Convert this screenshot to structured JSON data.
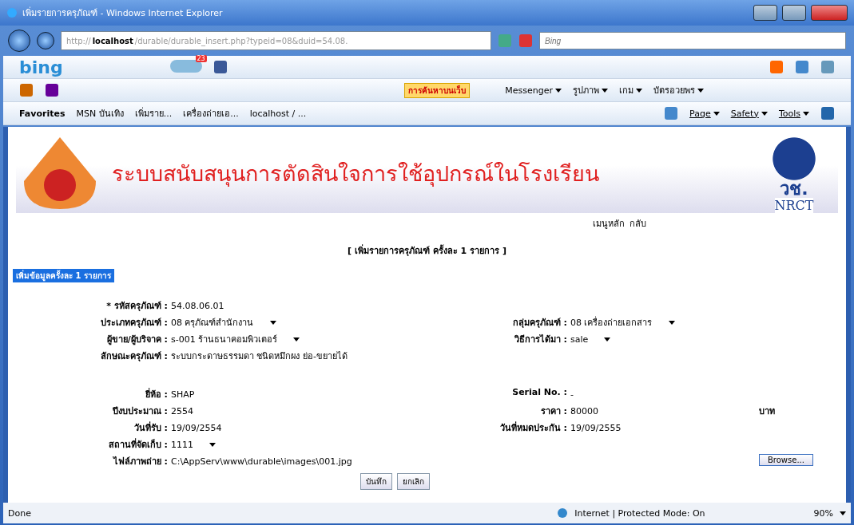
{
  "window": {
    "title": "เพิ่มรายการครุภัณฑ์ - Windows Internet Explorer"
  },
  "address_bar": {
    "url_prefix": "http://",
    "url_host": "localhost",
    "url_rest": "/durable/durable_insert.php?typeid=08&duid=54.08.",
    "search_placeholder": "Bing"
  },
  "bing_toolbar": {
    "logo": "bing",
    "badge": "23"
  },
  "search_toolbar": {
    "search_button": "การค้นหาบนเว็บ",
    "items": [
      "Messenger",
      "รูปภาพ",
      "เกม",
      "บัตรอวยพร"
    ]
  },
  "favorites_bar": {
    "label": "Favorites",
    "items": [
      "MSN บันเทิง",
      "เพิ่มราย...",
      "เครื่องถ่ายเอ...",
      "localhost / ..."
    ],
    "commands": [
      "Page",
      "Safety",
      "Tools"
    ]
  },
  "banner": {
    "title": "ระบบสนับสนุนการตัดสินใจการใช้อุปกรณ์ในโรงเรียน",
    "logo_text": "วช.",
    "logo_sub": "NRCT"
  },
  "nav_links": [
    "เมนูหลัก",
    "กลับ"
  ],
  "page_heading": "[ เพิ่มรายการครุภัณฑ์   ครั้งละ 1 รายการ ]",
  "section_tag": "เพิ่มข้อมูลครั้งละ 1 รายการ",
  "form_top": [
    {
      "left": {
        "label": "* รหัสครุภัณฑ์ :",
        "value": "54.08.06.01",
        "kind": "text"
      }
    },
    {
      "left": {
        "label": "ประเภทครุภัณฑ์ :",
        "value": "08 ครุภัณฑ์สำนักงาน",
        "kind": "select"
      },
      "right": {
        "label": "กลุ่มครุภัณฑ์ :",
        "value": "08 เครื่องถ่ายเอกสาร",
        "kind": "select"
      }
    },
    {
      "left": {
        "label": "ผู้ขาย/ผู้บริจาค :",
        "value": "s-001 ร้านธนาคอมพิวเตอร์",
        "kind": "select"
      },
      "right": {
        "label": "วิธีการได้มา :",
        "value": "sale",
        "kind": "select"
      }
    },
    {
      "left": {
        "label": "ลักษณะครุภัณฑ์ :",
        "value": "ระบบกระดาษธรรมดา ชนิดหมึกผง ย่อ-ขยายได้",
        "kind": "text"
      }
    }
  ],
  "form_bottom": [
    {
      "left": {
        "label": "ยี่ห้อ :",
        "value": "SHAP",
        "kind": "text"
      },
      "right": {
        "label": "Serial No. :",
        "value": "-",
        "kind": "text"
      }
    },
    {
      "left": {
        "label": "ปีงบประมาณ :",
        "value": "2554",
        "kind": "text"
      },
      "right": {
        "label": "ราคา :",
        "value": "80000",
        "kind": "text"
      },
      "unit": "บาท"
    },
    {
      "left": {
        "label": "วันที่รับ :",
        "value": "19/09/2554",
        "kind": "text"
      },
      "right": {
        "label": "วันที่หมดประกัน :",
        "value": "19/09/2555",
        "kind": "text"
      }
    },
    {
      "left": {
        "label": "สถานที่จัดเก็บ :",
        "value": "1111",
        "kind": "select"
      }
    },
    {
      "left": {
        "label": "ไฟล์ภาพถ่าย :",
        "value": "C:\\AppServ\\www\\durable\\images\\001.jpg",
        "kind": "file"
      },
      "browse": "Browse..."
    }
  ],
  "buttons": [
    "บันทึก",
    "ยกเลิก"
  ],
  "status_bar": {
    "status": "Done",
    "zone": "Internet | Protected Mode: On",
    "zoom": "90%"
  }
}
